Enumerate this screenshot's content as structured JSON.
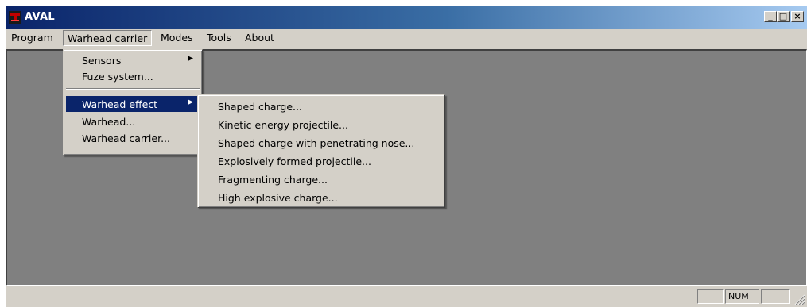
{
  "window": {
    "title": "AVAL",
    "controls": {
      "minimize": "_",
      "maximize": "□",
      "close": "×"
    }
  },
  "menubar": {
    "items": [
      "Program",
      "Warhead carrier",
      "Modes",
      "Tools",
      "About"
    ],
    "open_menu": "Warhead carrier"
  },
  "warhead_carrier_menu": {
    "items": [
      {
        "label": "Sensors",
        "submenu": true
      },
      {
        "label": "Fuze system...",
        "submenu": false
      },
      {
        "label": "Warhead effect",
        "submenu": true,
        "highlighted": true
      },
      {
        "label": "Warhead...",
        "submenu": false
      },
      {
        "label": "Warhead carrier...",
        "submenu": false
      }
    ],
    "submenu_arrow": "▶"
  },
  "warhead_effect_submenu": {
    "items": [
      "Shaped charge...",
      "Kinetic energy projectile...",
      "Shaped charge with penetrating nose...",
      "Explosively formed projectile...",
      "Fragmenting charge...",
      "High explosive charge..."
    ]
  },
  "statusbar": {
    "panes": [
      "",
      "NUM",
      ""
    ]
  },
  "colors": {
    "title_gradient_start": "#0a246a",
    "title_gradient_end": "#a6caf0",
    "face": "#d4d0c8",
    "client_background": "#808080",
    "highlight": "#0a246a"
  },
  "icons": {
    "app": "aval-app-icon",
    "submenu": "triangle-right-icon",
    "resize": "resize-grip-icon"
  }
}
